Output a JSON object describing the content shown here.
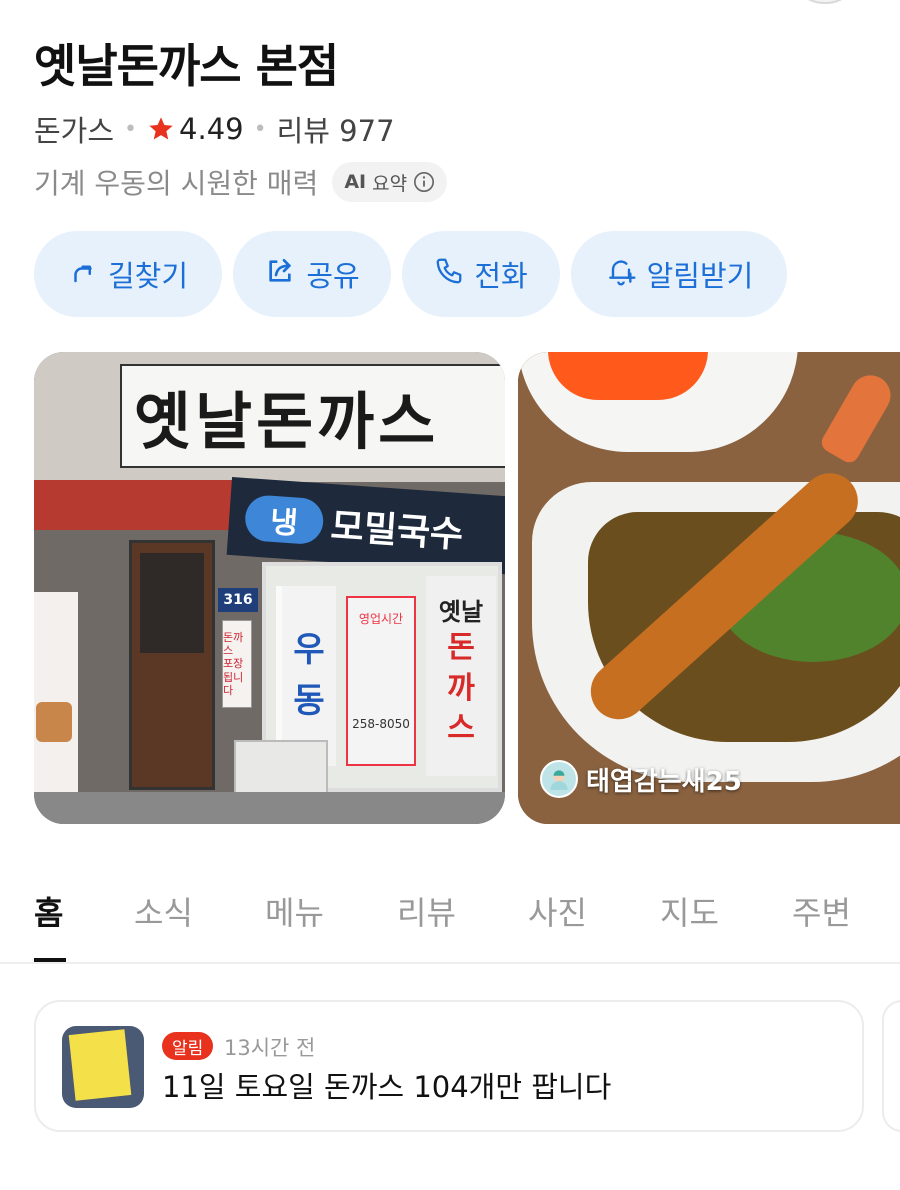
{
  "place": {
    "name": "옛날돈까스 본점",
    "category": "돈가스",
    "rating": "4.49",
    "review_label": "리뷰 977",
    "summary": "기계 우동의 시원한 매력",
    "ai_badge_ai": "AI",
    "ai_badge_label": "요약"
  },
  "actions": [
    {
      "label": "길찾기",
      "icon": "route-arrow-icon"
    },
    {
      "label": "공유",
      "icon": "share-icon"
    },
    {
      "label": "전화",
      "icon": "phone-icon"
    },
    {
      "label": "알림받기",
      "icon": "bell-plus-icon"
    }
  ],
  "photos": {
    "storefront": {
      "sign_text": "옛날돈까스",
      "banner_circle": "냉",
      "banner_text": "모밀국수",
      "door_number": "316",
      "vertical_sign": [
        "돈까스",
        "포장됩니다"
      ],
      "window_left": [
        "우",
        "동"
      ],
      "window_hours": "영업시간",
      "window_phone": "258-8050",
      "window_right_top": "옛날",
      "window_right": [
        "돈",
        "까",
        "스"
      ]
    },
    "food": {
      "credit_name": "태엽감는새25"
    }
  },
  "tabs": [
    {
      "label": "홈",
      "active": true
    },
    {
      "label": "소식",
      "active": false
    },
    {
      "label": "메뉴",
      "active": false
    },
    {
      "label": "리뷰",
      "active": false
    },
    {
      "label": "사진",
      "active": false
    },
    {
      "label": "지도",
      "active": false
    },
    {
      "label": "주변",
      "active": false
    }
  ],
  "notice": {
    "badge": "알림",
    "time": "13시간 전",
    "text": "11일 토요일 돈까스 104개만 팝니다"
  },
  "colors": {
    "accent_blue": "#1c6fd6",
    "action_bg": "#e6f1fc",
    "star_red": "#e8321e"
  }
}
